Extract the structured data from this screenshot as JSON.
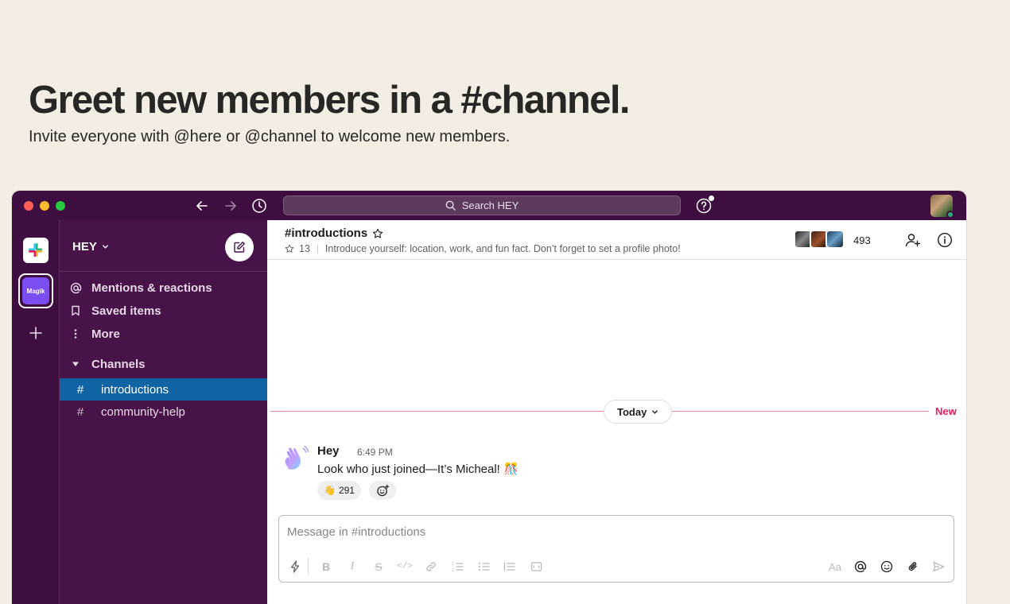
{
  "hero": {
    "title": "Greet new members in a #channel.",
    "subtitle": "Invite everyone with @here or @channel to welcome new members."
  },
  "titlebar": {
    "search_placeholder": "Search HEY"
  },
  "rail": {
    "workspace_tile_label": "Magik"
  },
  "sidebar": {
    "workspace_name": "HEY",
    "nav_items": [
      {
        "label": "Mentions & reactions",
        "icon": "at-icon"
      },
      {
        "label": "Saved items",
        "icon": "bookmark-icon"
      },
      {
        "label": "More",
        "icon": "more-vertical-icon"
      }
    ],
    "channels_header": "Channels",
    "channels": [
      {
        "name": "introductions",
        "active": true
      },
      {
        "name": "community-help",
        "active": false
      }
    ]
  },
  "channel": {
    "name": "#introductions",
    "pinned_count": "13",
    "topic": "Introduce yourself: location, work, and fun fact. Don’t forget to set a profile photo!",
    "member_count": "493"
  },
  "divider": {
    "day_label": "Today",
    "new_label": "New"
  },
  "message": {
    "author": "Hey",
    "time": "6:49 PM",
    "text": "Look who just joined—It’s Micheal! 🎊",
    "reaction_emoji": "👋",
    "reaction_count": "291"
  },
  "composer": {
    "placeholder": "Message in #introductions"
  },
  "colors": {
    "aubergine_titlebar": "#3f0e40",
    "aubergine_sidebar": "#481349",
    "active_channel": "#1164a3",
    "new_divider": "#e01e5a",
    "hero_background": "#f3ede4"
  }
}
